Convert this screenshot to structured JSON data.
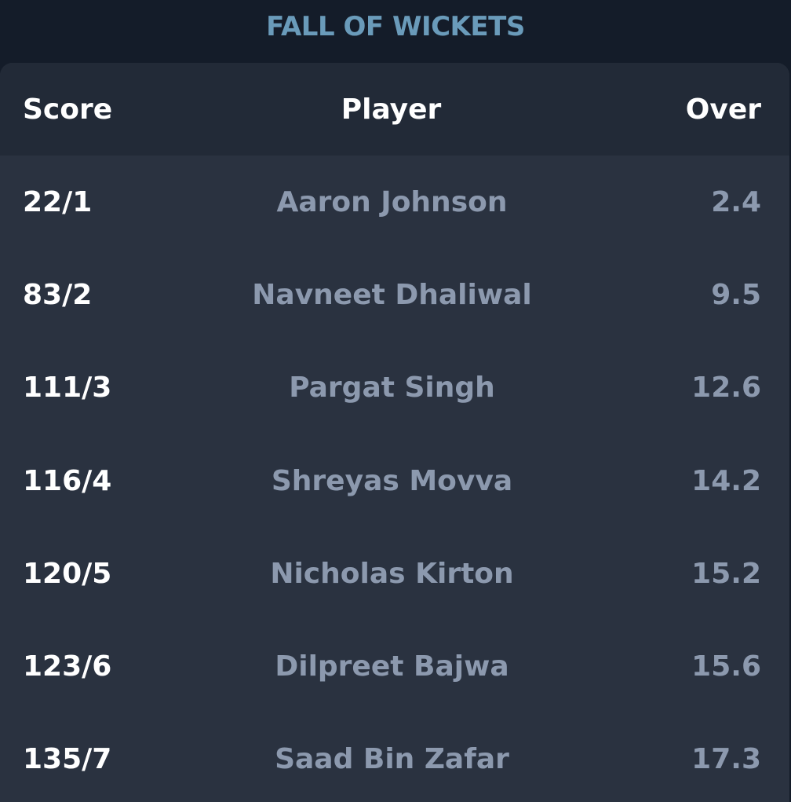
{
  "title": "FALL OF WICKETS",
  "columns": {
    "score": "Score",
    "player": "Player",
    "over": "Over"
  },
  "rows": [
    {
      "score": "22/1",
      "player": "Aaron Johnson",
      "over": "2.4"
    },
    {
      "score": "83/2",
      "player": "Navneet Dhaliwal",
      "over": "9.5"
    },
    {
      "score": "111/3",
      "player": "Pargat Singh",
      "over": "12.6"
    },
    {
      "score": "116/4",
      "player": "Shreyas Movva",
      "over": "14.2"
    },
    {
      "score": "120/5",
      "player": "Nicholas Kirton",
      "over": "15.2"
    },
    {
      "score": "123/6",
      "player": "Dilpreet Bajwa",
      "over": "15.6"
    },
    {
      "score": "135/7",
      "player": "Saad Bin Zafar",
      "over": "17.3"
    }
  ],
  "colors": {
    "background": "#141c29",
    "card": "#2a3240",
    "header": "#222a37",
    "title": "#6a9bba",
    "muted_text": "#8c99ae",
    "primary_text": "#ffffff"
  }
}
